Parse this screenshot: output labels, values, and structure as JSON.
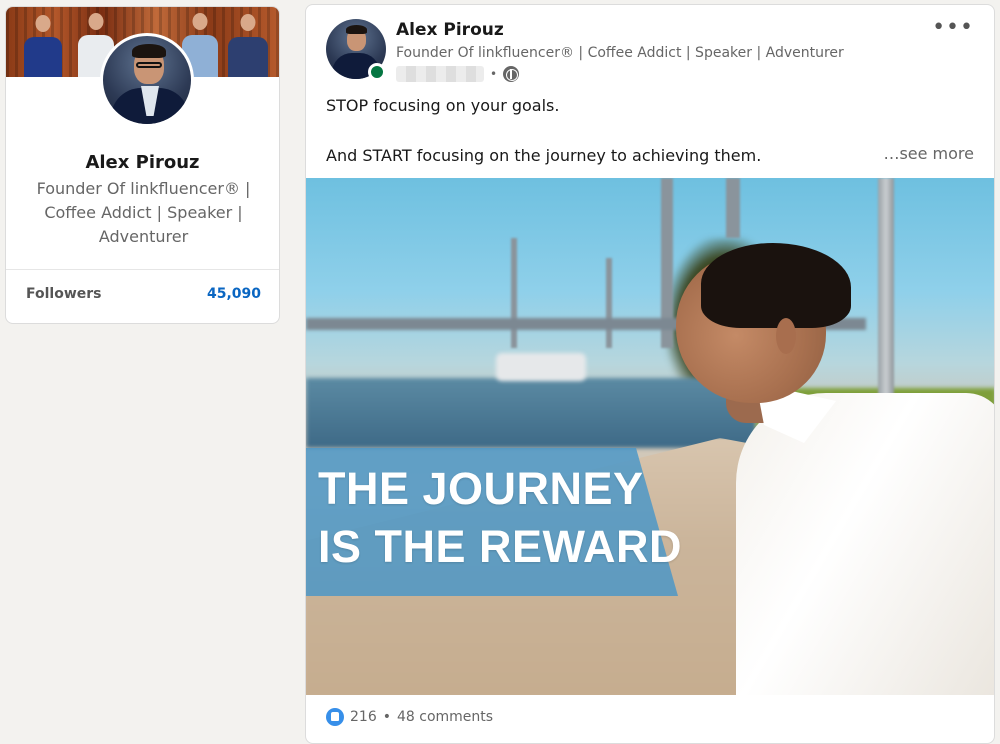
{
  "profile": {
    "name": "Alex Pirouz",
    "headline": "Founder Of linkfluencer® | Coffee Addict | Speaker | Adventurer",
    "followers_label": "Followers",
    "followers_count": "45,090"
  },
  "post": {
    "author": "Alex Pirouz",
    "headline": "Founder Of linkfluencer® | Coffee Addict | Speaker | Adventurer",
    "meta_separator": "•",
    "more_label": "•••",
    "text_line_1": "STOP focusing on your goals.",
    "text_line_2": "And START focusing on the journey to achieving them.",
    "see_more": "…see more",
    "image_title_line_1": "THE JOURNEY",
    "image_title_line_2": "IS THE REWARD",
    "reactions_count": "216",
    "footer_separator": "•",
    "comments": "48 comments"
  },
  "colors": {
    "page_bg": "#f3f2ef",
    "followers_count": "#0a66c2",
    "online": "#057642",
    "banner": "#4896c8",
    "like": "#378fe9"
  },
  "icons": [
    "globe-icon",
    "more-icon",
    "like-icon",
    "online-status-icon"
  ]
}
